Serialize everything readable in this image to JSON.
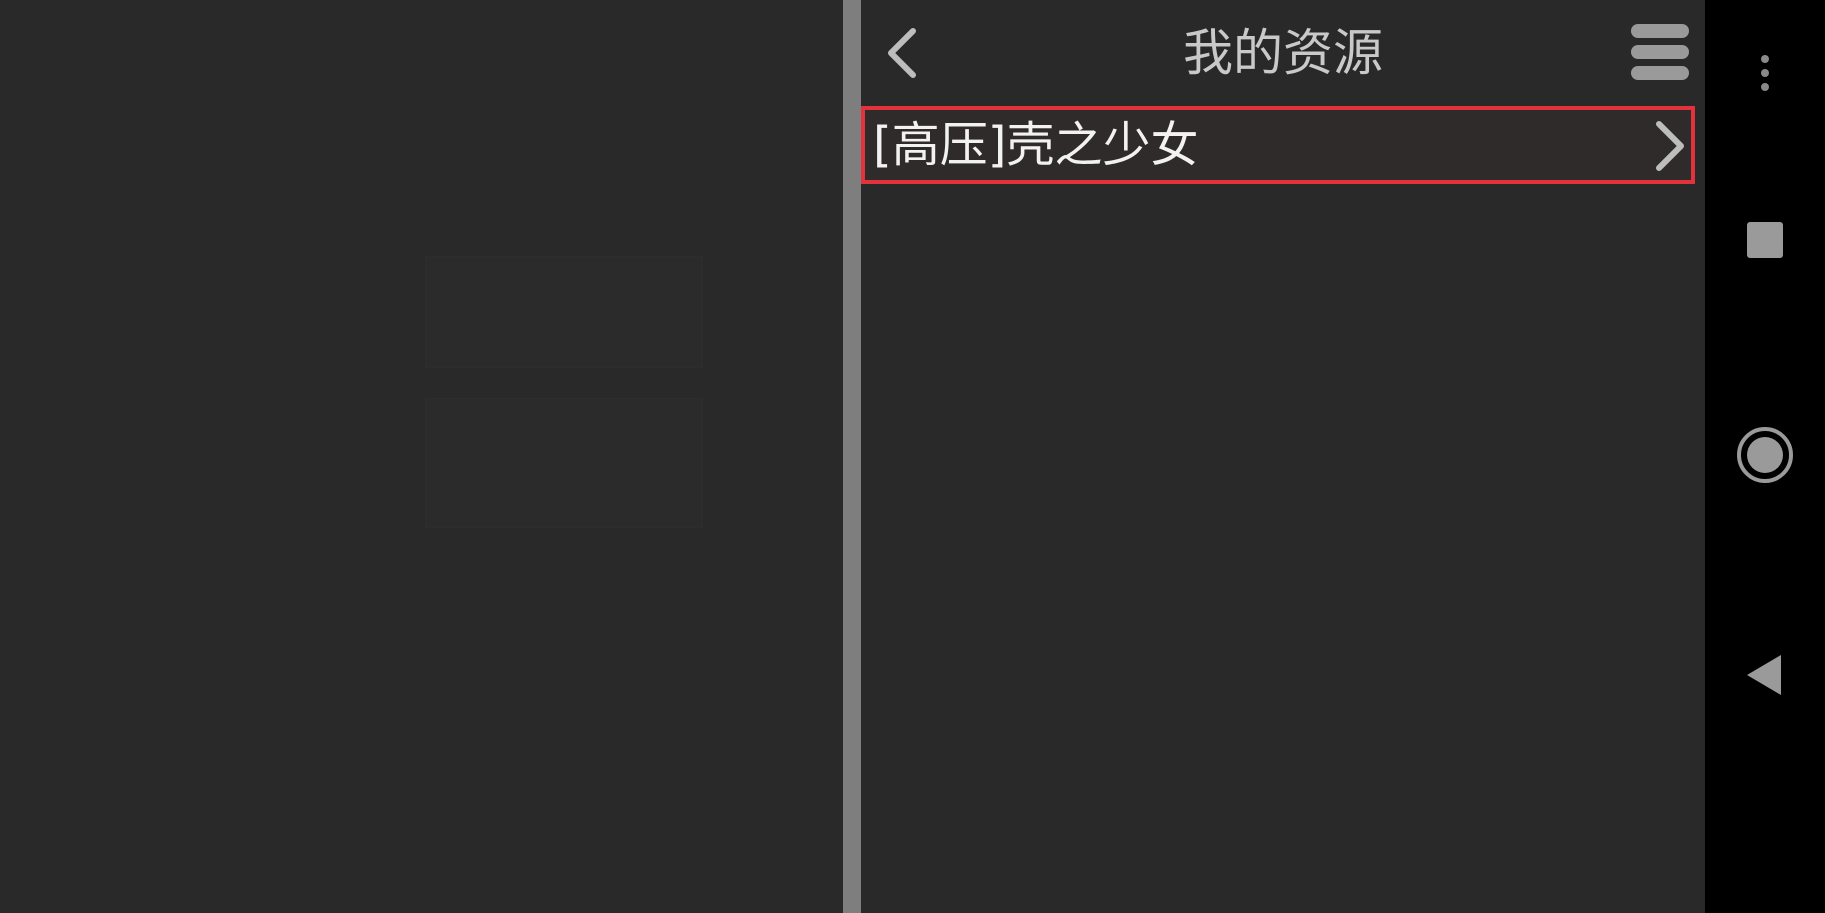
{
  "header": {
    "title": "我的资源",
    "back_icon": "chevron-left-icon",
    "menu_icon": "hamburger-menu-icon"
  },
  "resources": {
    "items": [
      {
        "label": "[高压]壳之少女",
        "icon": "chevron-right-icon",
        "highlighted": true
      }
    ]
  },
  "system_nav": {
    "icons": [
      "more-vert-icon",
      "recents-square-icon",
      "home-circle-icon",
      "back-triangle-icon"
    ]
  },
  "colors": {
    "background": "#2a2929",
    "divider": "#7e7e7e",
    "highlight_border": "#e2323b",
    "nav_bar": "#000000",
    "title_text": "#c9c9c9",
    "item_text": "#f2f2f2"
  }
}
